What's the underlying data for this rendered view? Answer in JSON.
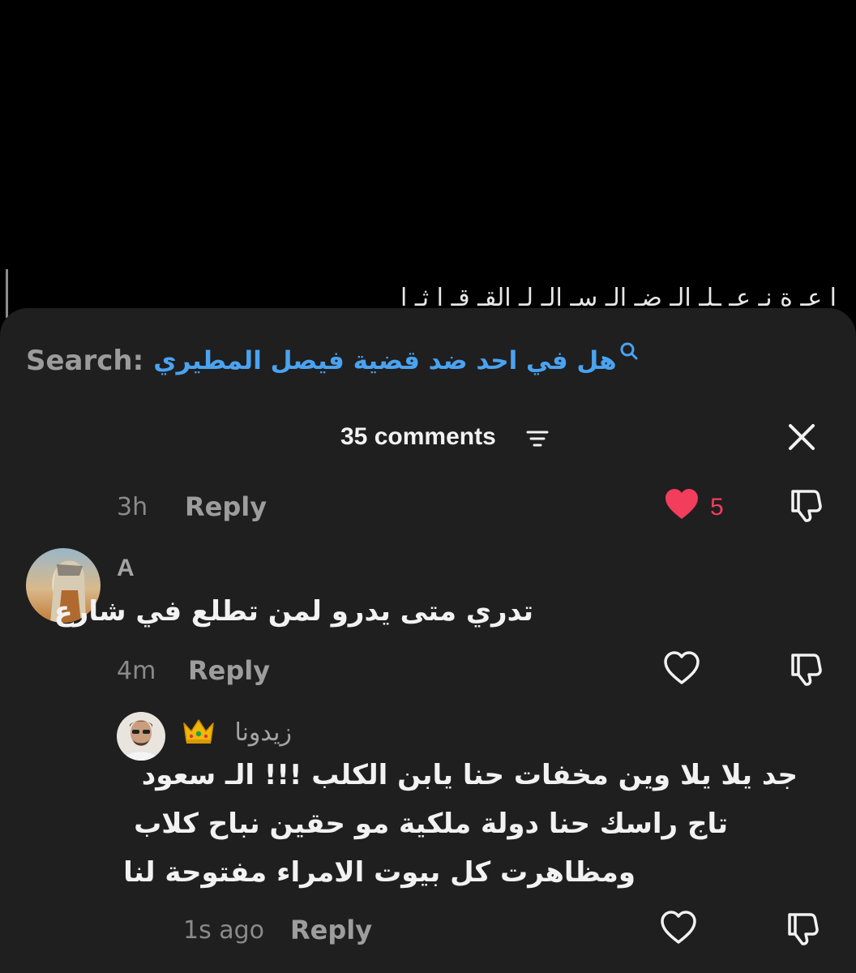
{
  "background": {
    "partial_text": "ا عـ ة نـ عـ ـلـ الـ ضـ الـ سـ الـ لـ القـ قـ ا ثـ ا"
  },
  "search": {
    "label": "Search:",
    "query": "هل في احد ضد قضية فيصل المطيري",
    "icon": "search-icon"
  },
  "header": {
    "comment_count": "35 comments",
    "filter_icon": "sort-filter-icon",
    "close_icon": "close-icon"
  },
  "comments": [
    {
      "time": "3h",
      "reply_label": "Reply",
      "liked": true,
      "like_count": "5"
    },
    {
      "username": "A",
      "text": "تدري متى يدرو لمن تطلع في شارع",
      "time": "4m",
      "reply_label": "Reply",
      "liked": false
    }
  ],
  "reply": {
    "username": "زيدونا",
    "badge": "👑",
    "lines": [
      "جد يلا يلا وين مخفات حنا يابن الكلب !!! الـ سعود",
      "تاج راسك حنا دولة ملكية مو حقين نباح كلاب",
      "ومظاهرت كل بيوت الامراء مفتوحة لنا"
    ],
    "time": "1s ago",
    "reply_label": "Reply",
    "liked": false
  },
  "colors": {
    "sheet": "#1f1f1f",
    "accent_blue": "#4aa3f0",
    "heart_red": "#f23d5c",
    "muted_text": "#9b9b9b",
    "primary_text": "#f2f2f2"
  }
}
